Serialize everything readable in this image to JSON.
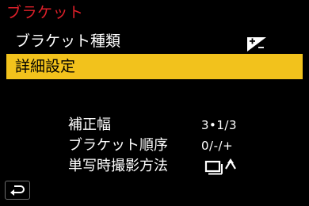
{
  "header": {
    "title": "ブラケット"
  },
  "menu": {
    "items": [
      {
        "label": "ブラケット種類",
        "value_icon": "exposure-bracket-icon"
      },
      {
        "label": "詳細設定",
        "selected": true
      }
    ]
  },
  "settings": [
    {
      "label": "補正幅",
      "value": "3•1/3"
    },
    {
      "label": "ブラケット順序",
      "value": "0/-/+"
    },
    {
      "label": "単写時撮影方法",
      "value_icon": "single-burst-mode-icon"
    }
  ],
  "footer": {
    "back_icon": "back-return-icon"
  },
  "colors": {
    "title": "#e0202a",
    "highlight": "#f2c21c",
    "background": "#000000",
    "text": "#ffffff"
  }
}
